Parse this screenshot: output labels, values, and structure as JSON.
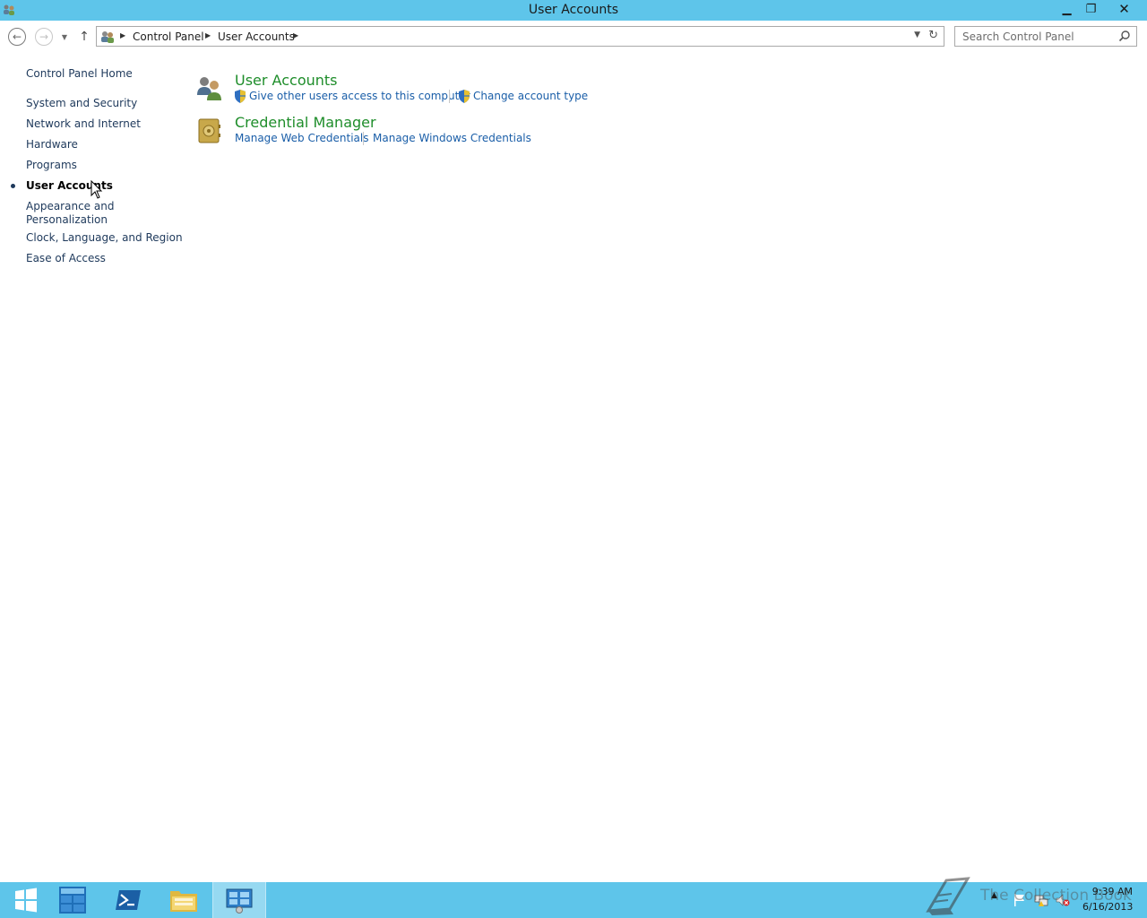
{
  "window": {
    "title": "User Accounts",
    "controls": {
      "minimize": "▁",
      "maximize": "❐",
      "close": "✕"
    }
  },
  "nav": {
    "back_icon": "back-arrow-icon",
    "forward_icon": "forward-arrow-icon",
    "recent_icon": "chevron-down-icon",
    "up_icon": "up-arrow-icon"
  },
  "address": {
    "breadcrumbs": [
      "Control Panel",
      "User Accounts"
    ],
    "sep": "▶"
  },
  "search": {
    "placeholder": "Search Control Panel"
  },
  "sidebar": {
    "items": [
      {
        "label": "Control Panel Home"
      },
      {
        "label": "System and Security"
      },
      {
        "label": "Network and Internet"
      },
      {
        "label": "Hardware"
      },
      {
        "label": "Programs"
      },
      {
        "label": "User Accounts",
        "active": true
      },
      {
        "label": "Appearance and"
      },
      {
        "label": "Personalization"
      },
      {
        "label": "Clock, Language, and Region"
      },
      {
        "label": "Ease of Access"
      }
    ]
  },
  "main": {
    "categories": [
      {
        "title": "User Accounts",
        "icon": "users-icon",
        "tasks": [
          "Give other users access to this computer",
          "Change account type"
        ]
      },
      {
        "title": "Credential Manager",
        "icon": "vault-icon",
        "tasks": [
          "Manage Web Credentials",
          "Manage Windows Credentials"
        ]
      }
    ]
  },
  "taskbar": {
    "buttons": [
      "start-icon",
      "server-manager-icon",
      "powershell-icon",
      "file-explorer-icon",
      "control-panel-icon"
    ],
    "clock": {
      "time": "9:39 AM",
      "date": "6/16/2013"
    },
    "watermark": "The Collection Book"
  },
  "colors": {
    "chrome": "#5ec5ea",
    "category_title": "#1e8d2a",
    "task_link": "#1a5ea8",
    "nav_link": "#1e395b"
  }
}
